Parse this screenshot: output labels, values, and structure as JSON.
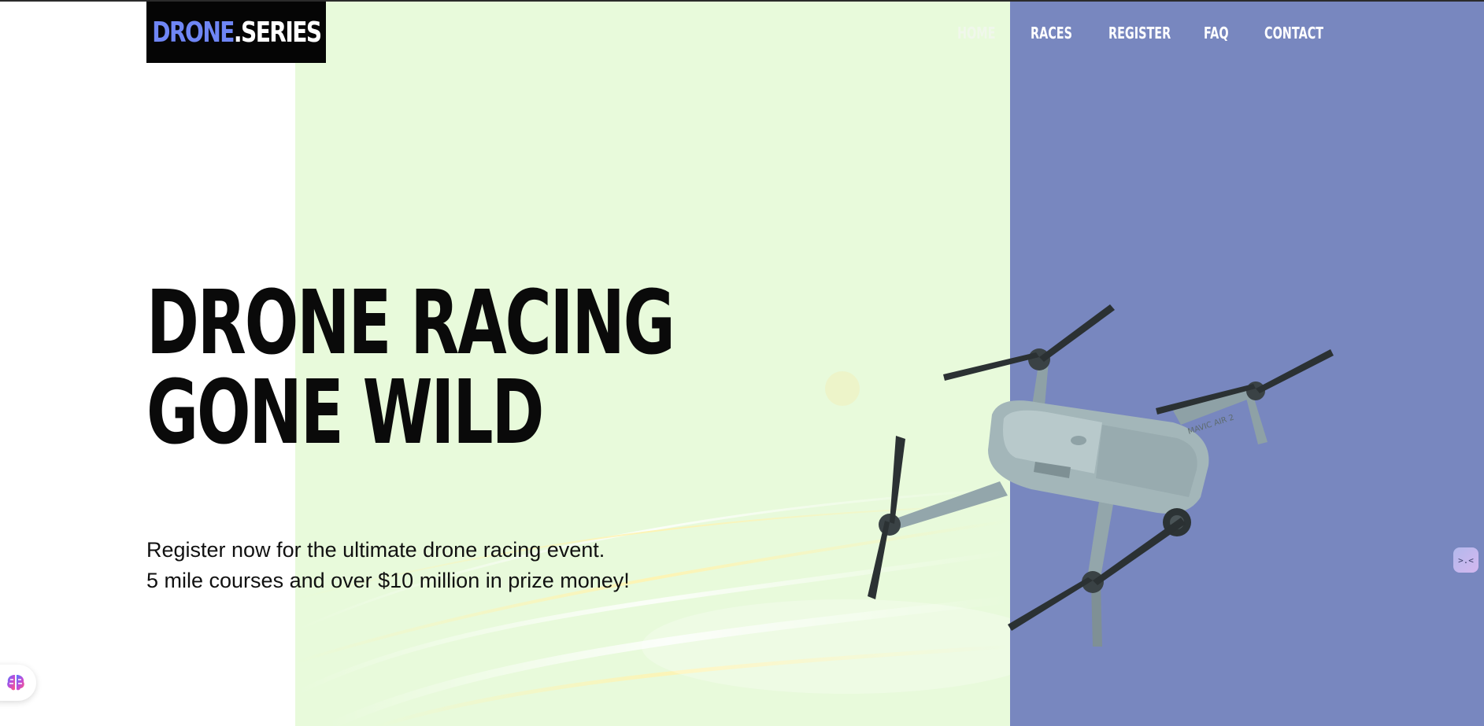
{
  "logo": {
    "part1": "DRONE",
    "part2": ".SERIES"
  },
  "nav": {
    "items": [
      {
        "label": "HOME",
        "active": true
      },
      {
        "label": "RACES",
        "active": false
      },
      {
        "label": "REGISTER",
        "active": false
      },
      {
        "label": "FAQ",
        "active": false
      },
      {
        "label": "CONTACT",
        "active": false
      }
    ]
  },
  "hero": {
    "title_line1": "DRONE RACING",
    "title_line2": "GONE WILD",
    "subtitle_line1": "Register now for the ultimate drone racing event.",
    "subtitle_line2": "5 mile courses and over $10 million in prize money!"
  },
  "widgets": {
    "brain_icon": "brain-icon",
    "side_icon": "assistant-face-icon",
    "side_glyph": ">.<"
  },
  "colors": {
    "accent_blue": "#6f86f5",
    "panel_green": "#e8fadb",
    "panel_purple": "#7887bf",
    "logo_bg": "#050505"
  }
}
